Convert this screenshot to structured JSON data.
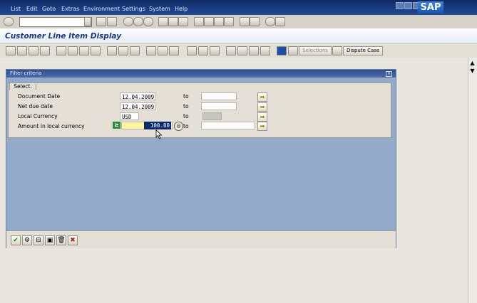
{
  "menu": {
    "items": [
      "List",
      "Edit",
      "Goto",
      "Extras",
      "Environment",
      "Settings",
      "System",
      "Help"
    ],
    "logo": "SAP"
  },
  "page": {
    "title": "Customer Line Item Display"
  },
  "app_toolbar": {
    "selections_label": "Selections",
    "dispute_case_label": "Dispute Case"
  },
  "dialog": {
    "title": "Filter criteria",
    "tab_label": "Select.",
    "rows": [
      {
        "label": "Document Date",
        "from": "12.04.2009",
        "to_label": "to",
        "to": ""
      },
      {
        "label": "Net due date",
        "from": "12.04.2009",
        "to_label": "to",
        "to": ""
      },
      {
        "label": "Local Currency",
        "from": "USD",
        "to_label": "to",
        "to": ""
      },
      {
        "label": "Amount in local currency",
        "from": "100.00",
        "to_label": "to",
        "to": ""
      }
    ],
    "operator_icon": "greater-equal-icon",
    "footer_icons": [
      "check-icon",
      "define-icon",
      "delete-row-icon",
      "save-icon",
      "trash-icon",
      "cancel-icon"
    ]
  },
  "colors": {
    "menubar": "#1b3e83",
    "dialog_body": "#93abc8",
    "title_text": "#1d3b7c",
    "required_field": "#fff6a3"
  }
}
